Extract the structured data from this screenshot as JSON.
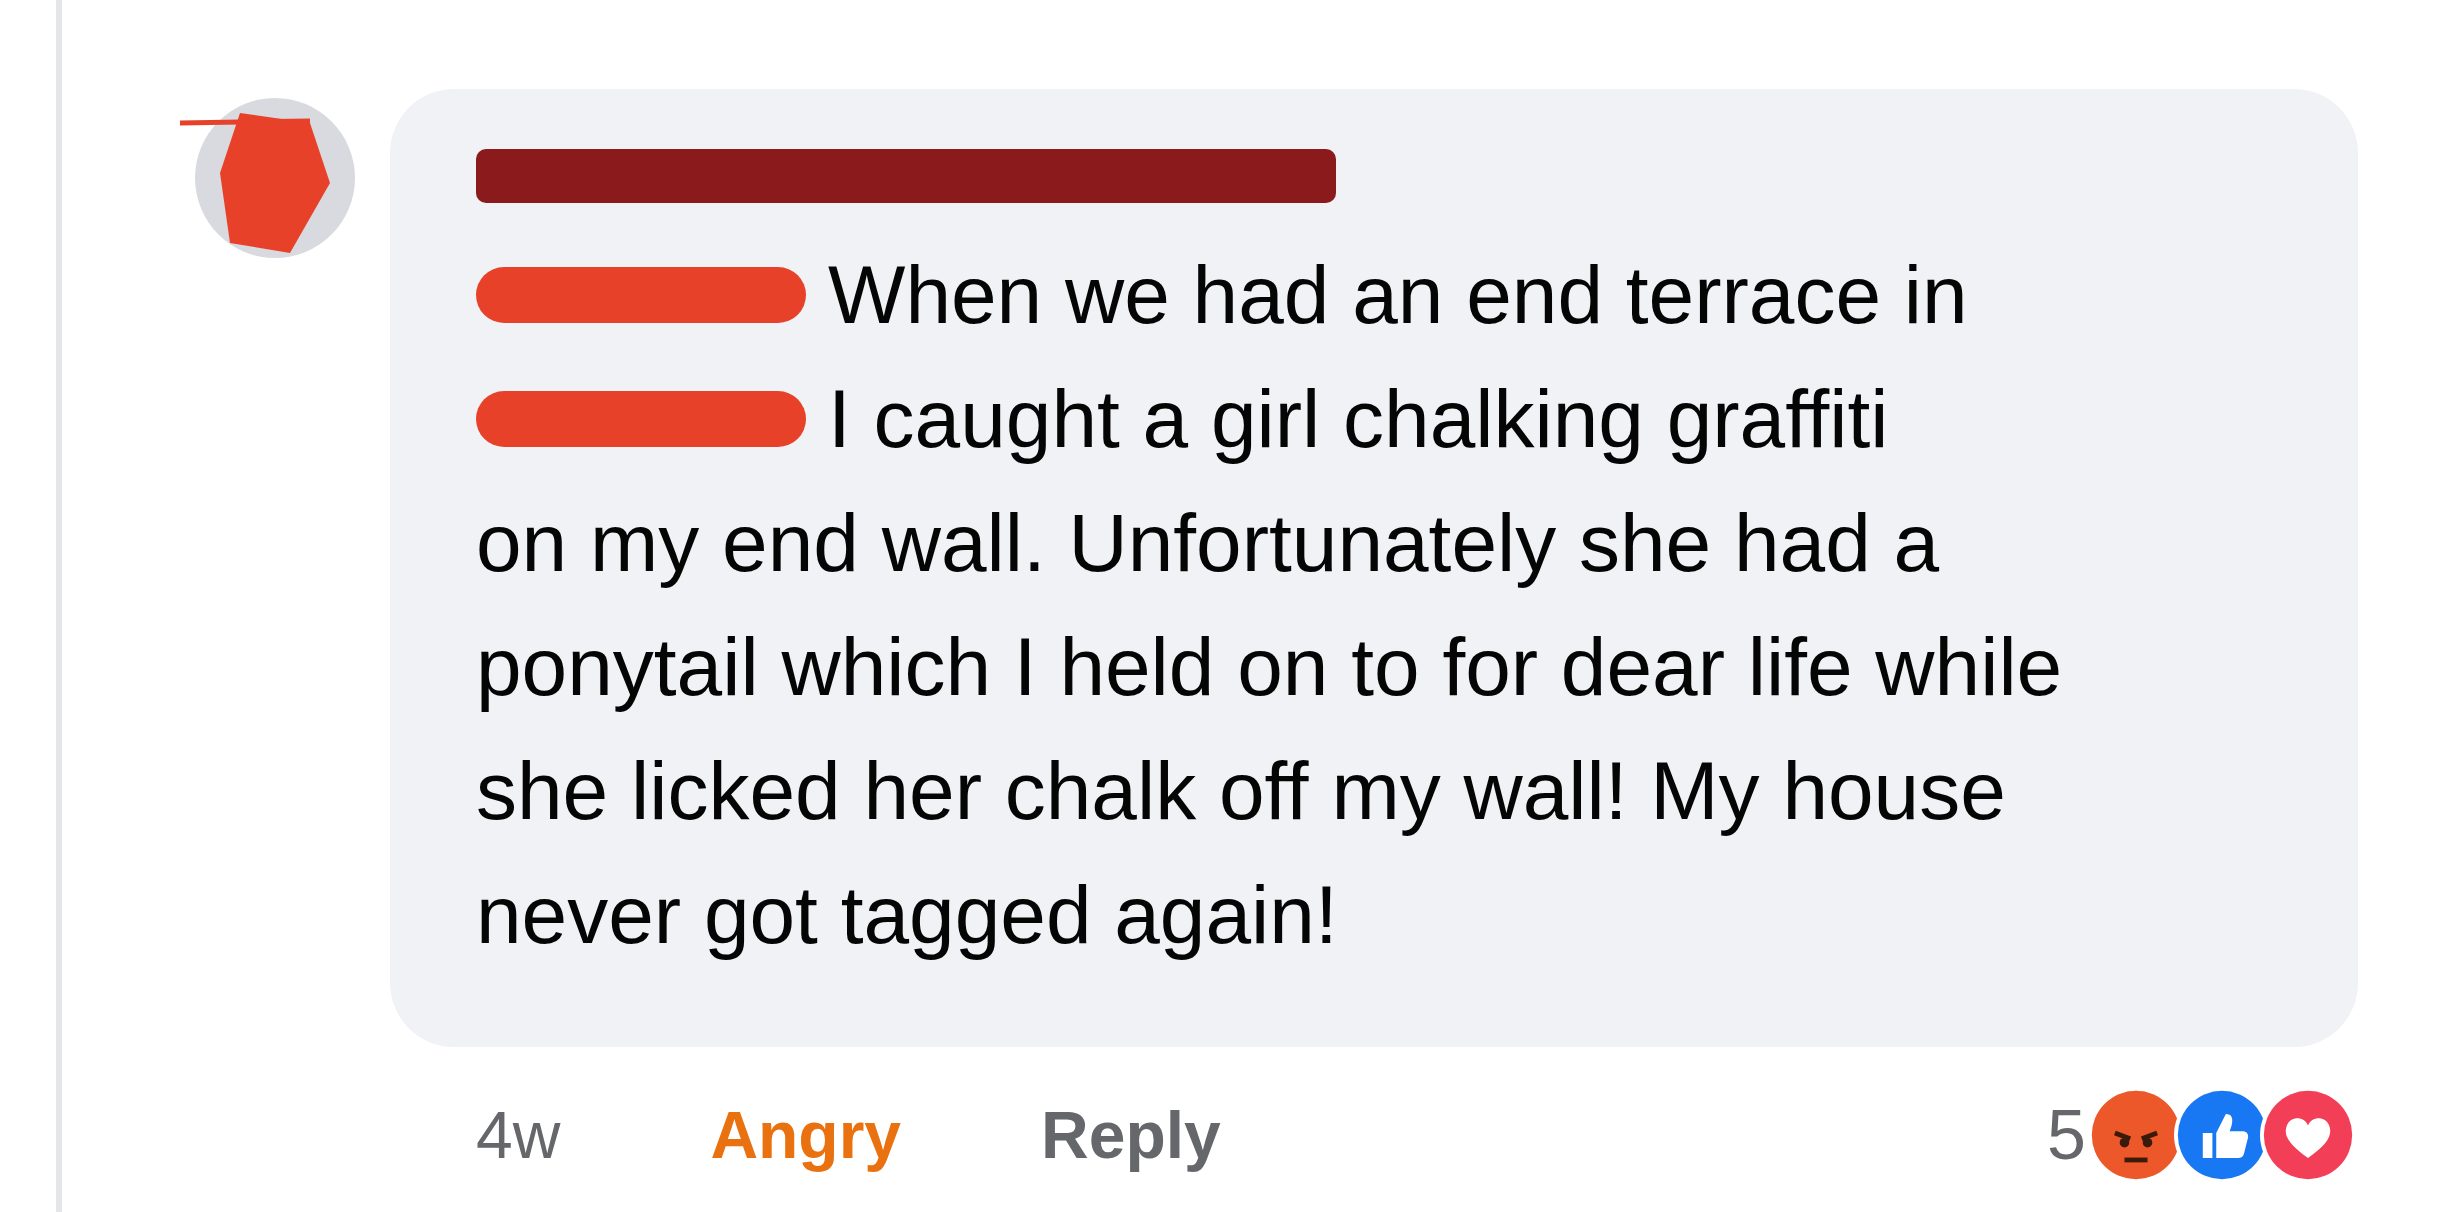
{
  "comment": {
    "lines": [
      {
        "redacted": true,
        "text": "When we had an end terrace in"
      },
      {
        "redacted": true,
        "text": "I caught a girl chalking graffiti"
      },
      {
        "redacted": false,
        "text": "on my end wall. Unfortunately she had a ponytail which I held on to for dear life while she licked her chalk off my wall! My house never got tagged again!"
      }
    ],
    "time": "4w",
    "reaction_label": "Angry",
    "reply": "Reply",
    "reaction_count": "5",
    "reactions": [
      {
        "kind": "angry"
      },
      {
        "kind": "like"
      },
      {
        "kind": "love"
      }
    ]
  }
}
